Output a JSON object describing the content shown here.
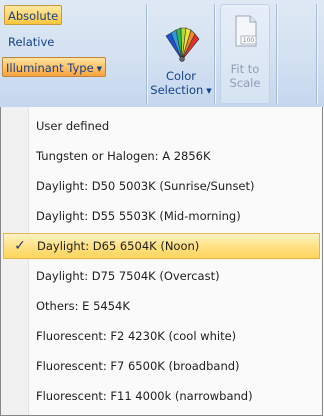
{
  "ribbon": {
    "absolute_label": "Absolute",
    "relative_label": "Relative",
    "illuminant_type_label": "Illuminant Type",
    "color_selection_label_1": "Color",
    "color_selection_label_2": "Selection",
    "fit_to_scale_label_1": "Fit to",
    "fit_to_scale_label_2": "Scale",
    "fit_icon_value": "100",
    "accent_color": "#ffc63d"
  },
  "menu": {
    "check_glyph": "✓",
    "items": [
      {
        "label": "User defined",
        "selected": false
      },
      {
        "label": "Tungsten or Halogen: A 2856K",
        "selected": false
      },
      {
        "label": "Daylight: D50 5003K (Sunrise/Sunset)",
        "selected": false
      },
      {
        "label": "Daylight: D55 5503K (Mid-morning)",
        "selected": false
      },
      {
        "label": "Daylight: D65 6504K (Noon)",
        "selected": true
      },
      {
        "label": "Daylight: D75 7504K (Overcast)",
        "selected": false
      },
      {
        "label": "Others: E 5454K",
        "selected": false
      },
      {
        "label": "Fluorescent: F2 4230K (cool white)",
        "selected": false
      },
      {
        "label": "Fluorescent: F7 6500K (broadband)",
        "selected": false
      },
      {
        "label": "Fluorescent: F11 4000k (narrowband)",
        "selected": false
      }
    ]
  }
}
